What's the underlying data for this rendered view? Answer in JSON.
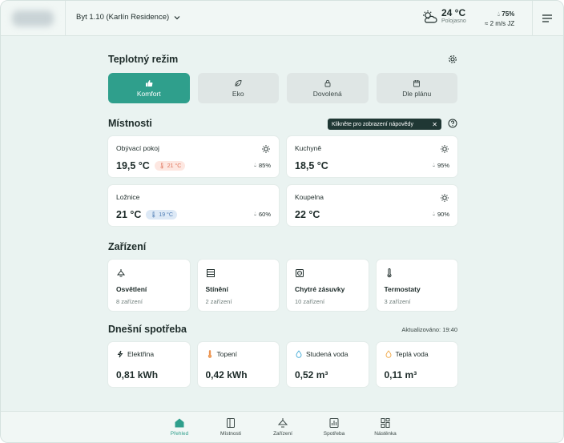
{
  "header": {
    "flat": "Byt 1.10 (Karlín Residence)",
    "weather_temp": "24 °C",
    "weather_desc": "Polojasno",
    "humidity": "75%",
    "wind": "2 m/s JZ"
  },
  "temperature_mode": {
    "title": "Teplotný režim",
    "modes": [
      {
        "label": "Komfort",
        "icon": "thumbs-up-icon",
        "active": true
      },
      {
        "label": "Eko",
        "icon": "leaf-icon",
        "active": false
      },
      {
        "label": "Dovolená",
        "icon": "lock-icon",
        "active": false
      },
      {
        "label": "Dle plánu",
        "icon": "calendar-icon",
        "active": false
      }
    ]
  },
  "rooms": {
    "title": "Místnosti",
    "tooltip": "Klikněte pro zobrazení nápovědy",
    "items": [
      {
        "name": "Obývací pokoj",
        "temp": "19,5 °C",
        "target": "21 °C",
        "target_kind": "warm",
        "humidity": "85%"
      },
      {
        "name": "Kuchyně",
        "temp": "18,5 °C",
        "target": "",
        "humidity": "95%"
      },
      {
        "name": "Ložnice",
        "temp": "21 °C",
        "target": "19 °C",
        "target_kind": "cool",
        "humidity": "60%"
      },
      {
        "name": "Koupelna",
        "temp": "22 °C",
        "target": "",
        "humidity": "90%"
      }
    ]
  },
  "devices": {
    "title": "Zařízení",
    "items": [
      {
        "name": "Osvětlení",
        "count": "8 zařízení",
        "icon": "lamp-icon"
      },
      {
        "name": "Stínění",
        "count": "2 zařízení",
        "icon": "blinds-icon"
      },
      {
        "name": "Chytré zásuvky",
        "count": "10 zařízení",
        "icon": "socket-icon"
      },
      {
        "name": "Termostaty",
        "count": "3 zařízení",
        "icon": "thermometer-icon"
      }
    ]
  },
  "consumption": {
    "title": "Dnešní spotřeba",
    "updated": "Aktualizováno: 19:40",
    "items": [
      {
        "label": "Elektřina",
        "value": "0,81 kWh",
        "icon": "lightning-icon"
      },
      {
        "label": "Topení",
        "value": "0,42 kWh",
        "icon": "thermometer-icon"
      },
      {
        "label": "Studená voda",
        "value": "0,52 m³",
        "icon": "drop-icon"
      },
      {
        "label": "Teplá voda",
        "value": "0,11 m³",
        "icon": "drop-icon"
      }
    ]
  },
  "nav": [
    {
      "label": "Přehled",
      "active": true
    },
    {
      "label": "Místnosti",
      "active": false
    },
    {
      "label": "Zařízení",
      "active": false
    },
    {
      "label": "Spotřeba",
      "active": false
    },
    {
      "label": "Nástěnka",
      "active": false
    }
  ],
  "colors": {
    "accent": "#2f9f8c",
    "background": "#eaf3f1"
  }
}
